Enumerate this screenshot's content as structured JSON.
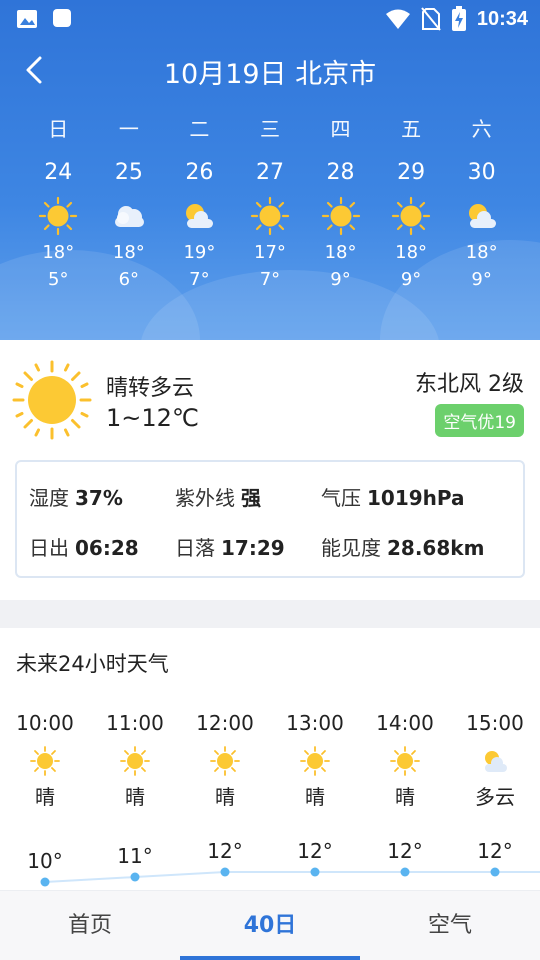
{
  "status_bar": {
    "time": "10:34"
  },
  "header": {
    "title": "10月19日 北京市"
  },
  "week": [
    {
      "weekday": "日",
      "date": "24",
      "icon": "sun-icon",
      "high": "18°",
      "low": "5°"
    },
    {
      "weekday": "一",
      "date": "25",
      "icon": "cloud-icon",
      "high": "18°",
      "low": "6°"
    },
    {
      "weekday": "二",
      "date": "26",
      "icon": "partly-cloudy-icon",
      "high": "19°",
      "low": "7°"
    },
    {
      "weekday": "三",
      "date": "27",
      "icon": "sun-icon",
      "high": "17°",
      "low": "7°"
    },
    {
      "weekday": "四",
      "date": "28",
      "icon": "sun-icon",
      "high": "18°",
      "low": "9°"
    },
    {
      "weekday": "五",
      "date": "29",
      "icon": "sun-icon",
      "high": "18°",
      "low": "9°"
    },
    {
      "weekday": "六",
      "date": "30",
      "icon": "partly-cloudy-icon",
      "high": "18°",
      "low": "9°"
    }
  ],
  "today": {
    "condition": "晴转多云",
    "temp_range": "1~12℃",
    "wind": "东北风 2级",
    "aqi": "空气优19",
    "aqi_color": "#6cd06c",
    "details": {
      "humidity_label": "湿度",
      "humidity": "37%",
      "uv_label": "紫外线",
      "uv": "强",
      "pressure_label": "气压",
      "pressure": "1019hPa",
      "sunrise_label": "日出",
      "sunrise": "06:28",
      "sunset_label": "日落",
      "sunset": "17:29",
      "visibility_label": "能见度",
      "visibility": "28.68km"
    }
  },
  "hourly": {
    "title": "未来24小时天气",
    "items": [
      {
        "time": "10:00",
        "icon": "sun-icon",
        "condition": "晴",
        "temp": 10,
        "temp_label": "10°"
      },
      {
        "time": "11:00",
        "icon": "sun-icon",
        "condition": "晴",
        "temp": 11,
        "temp_label": "11°"
      },
      {
        "time": "12:00",
        "icon": "sun-icon",
        "condition": "晴",
        "temp": 12,
        "temp_label": "12°"
      },
      {
        "time": "13:00",
        "icon": "sun-icon",
        "condition": "晴",
        "temp": 12,
        "temp_label": "12°"
      },
      {
        "time": "14:00",
        "icon": "sun-icon",
        "condition": "晴",
        "temp": 12,
        "temp_label": "12°"
      },
      {
        "time": "15:00",
        "icon": "partly-cloudy-icon",
        "condition": "多云",
        "temp": 12,
        "temp_label": "12°"
      }
    ]
  },
  "nav": {
    "home": "首页",
    "forty_day": "40日",
    "air": "空气"
  },
  "colors": {
    "accent": "#2f74d8",
    "sun": "#fbc02d",
    "line": "#cfe6fb",
    "dot": "#5ab4f0"
  }
}
